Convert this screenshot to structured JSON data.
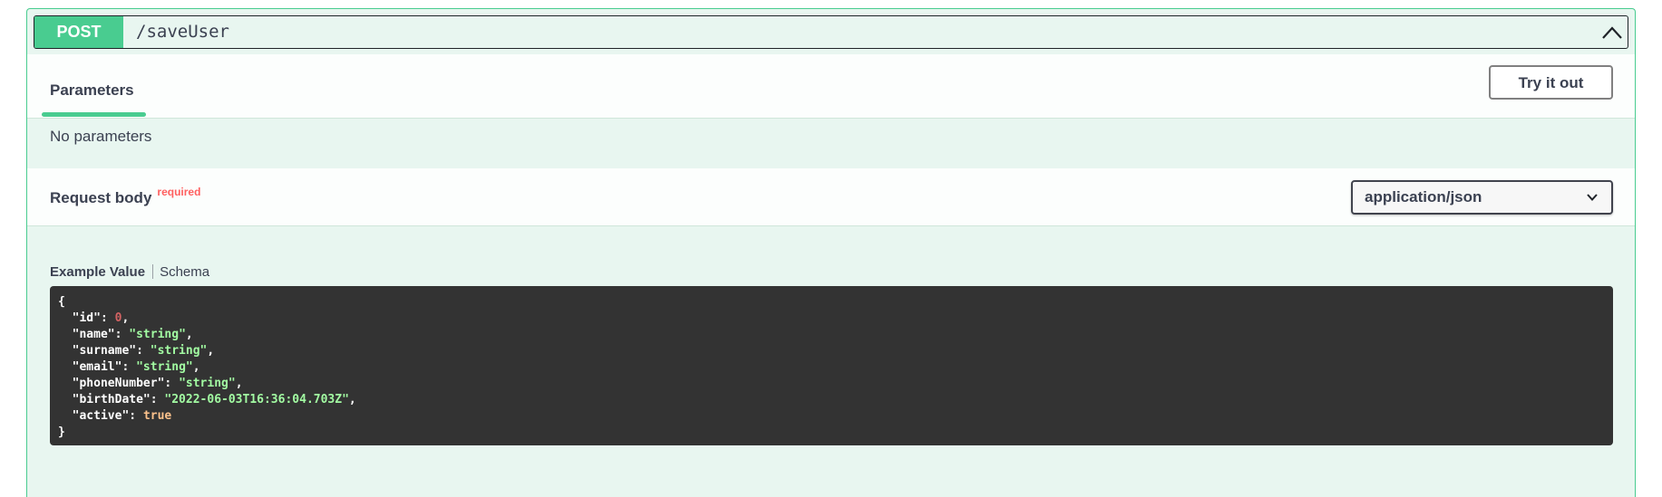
{
  "summary": {
    "method": "POST",
    "path": "/saveUser"
  },
  "tabs": {
    "parameters_label": "Parameters",
    "try_label": "Try it out"
  },
  "parameters": {
    "empty_text": "No parameters"
  },
  "request_body": {
    "title": "Request body",
    "required_label": "required",
    "content_type": "application/json"
  },
  "model_tabs": {
    "example_label": "Example Value",
    "schema_label": "Schema"
  },
  "example": {
    "open": "{",
    "close": "}",
    "fields": [
      {
        "key": "\"id\"",
        "value": "0",
        "type": "num",
        "comma": ","
      },
      {
        "key": "\"name\"",
        "value": "\"string\"",
        "type": "str",
        "comma": ","
      },
      {
        "key": "\"surname\"",
        "value": "\"string\"",
        "type": "str",
        "comma": ","
      },
      {
        "key": "\"email\"",
        "value": "\"string\"",
        "type": "str",
        "comma": ","
      },
      {
        "key": "\"phoneNumber\"",
        "value": "\"string\"",
        "type": "str",
        "comma": ","
      },
      {
        "key": "\"birthDate\"",
        "value": "\"2022-06-03T16:36:04.703Z\"",
        "type": "str",
        "comma": ","
      },
      {
        "key": "\"active\"",
        "value": "true",
        "type": "bool",
        "comma": ""
      }
    ]
  },
  "colors": {
    "post_green": "#49cc90",
    "block_bg": "#e8f6f0",
    "code_bg": "#333333",
    "required_red": "#ff6060"
  }
}
